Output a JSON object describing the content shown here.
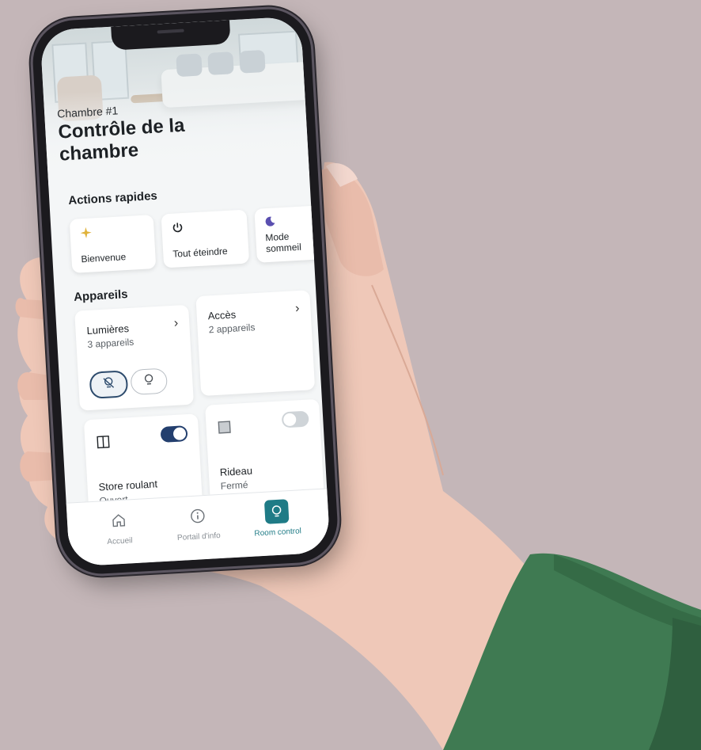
{
  "header": {
    "room_label": "Chambre #1",
    "title": "Contrôle de la chambre"
  },
  "quick_actions": {
    "title": "Actions rapides",
    "items": [
      {
        "label": "Bienvenue",
        "icon": "sparkle-icon",
        "color": "#e0b23a"
      },
      {
        "label": "Tout éteindre",
        "icon": "power-icon",
        "color": "#1d2125"
      },
      {
        "label": "Mode sommeil",
        "icon": "moon-icon",
        "color": "#5a4fb0"
      }
    ]
  },
  "devices": {
    "title": "Appareils",
    "lights": {
      "name": "Lumières",
      "count": "3 appareils"
    },
    "access": {
      "name": "Accès",
      "count": "2 appareils"
    },
    "blind": {
      "name": "Store roulant",
      "state": "Ouvert",
      "toggle_on": true
    },
    "curtain": {
      "name": "Rideau",
      "state": "Fermé",
      "toggle_on": false
    }
  },
  "tabs": [
    {
      "label": "Accueil",
      "icon": "home-icon",
      "active": false
    },
    {
      "label": "Portail d'info",
      "icon": "info-icon",
      "active": false
    },
    {
      "label": "Room control",
      "icon": "lightbulb-icon",
      "active": true
    }
  ],
  "colors": {
    "background": "#c4b6b8",
    "accent": "#1f7b86",
    "toggle_on": "#233f6e",
    "sleeve": "#3f7a52",
    "skin": "#efc8b8"
  }
}
